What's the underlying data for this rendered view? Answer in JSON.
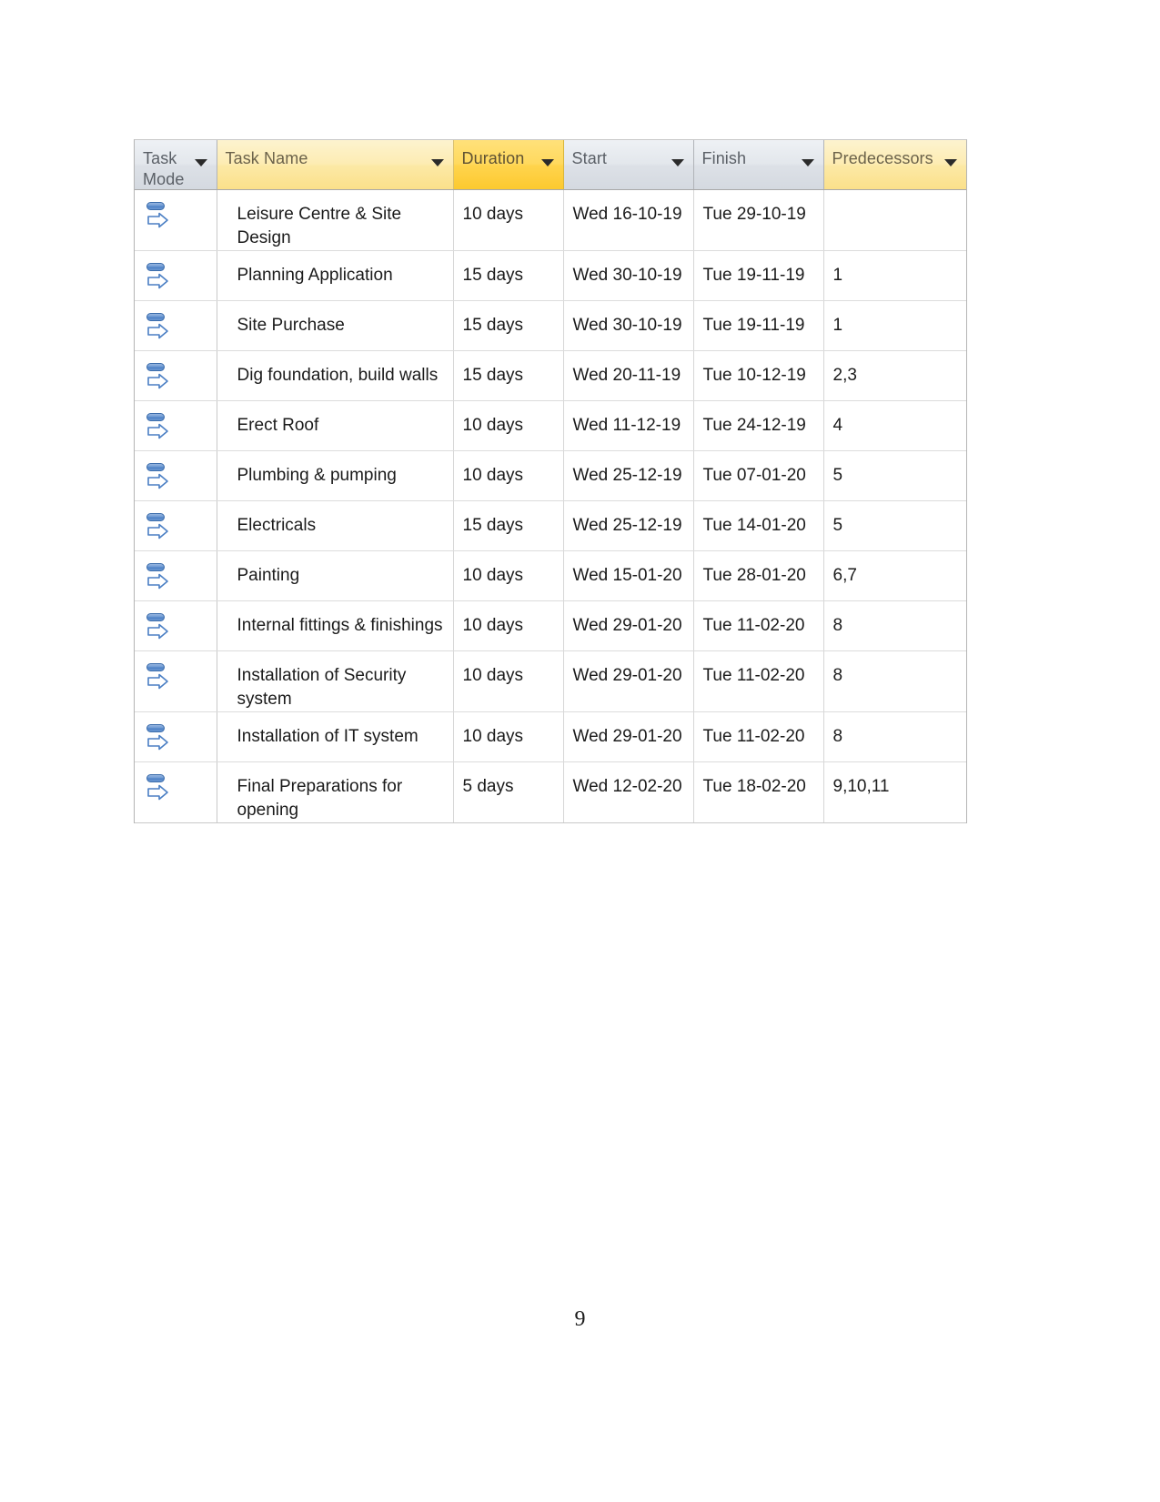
{
  "document": {
    "page_number": "9"
  },
  "table": {
    "name": "project-task-table",
    "columns": [
      {
        "id": "task_mode",
        "label": "Task\nMode",
        "style": "grey"
      },
      {
        "id": "task_name",
        "label": "Task Name",
        "style": "light-yellow"
      },
      {
        "id": "duration",
        "label": "Duration",
        "style": "gold"
      },
      {
        "id": "start",
        "label": "Start",
        "style": "grey"
      },
      {
        "id": "finish",
        "label": "Finish",
        "style": "grey"
      },
      {
        "id": "predecessors",
        "label": "Predecessors",
        "style": "light-yellow"
      }
    ],
    "filter_icon": "chevron-down-icon",
    "task_mode_icon": "manually-scheduled-task-icon",
    "rows": [
      {
        "task_name": "Leisure Centre & Site Design",
        "duration": "10 days",
        "start": "Wed 16-10-19",
        "finish": "Tue 29-10-19",
        "predecessors": ""
      },
      {
        "task_name": "Planning Application",
        "duration": "15 days",
        "start": "Wed 30-10-19",
        "finish": "Tue 19-11-19",
        "predecessors": "1"
      },
      {
        "task_name": "Site Purchase",
        "duration": "15 days",
        "start": "Wed 30-10-19",
        "finish": "Tue 19-11-19",
        "predecessors": "1"
      },
      {
        "task_name": "Dig foundation, build walls",
        "duration": "15 days",
        "start": "Wed 20-11-19",
        "finish": "Tue 10-12-19",
        "predecessors": "2,3"
      },
      {
        "task_name": "Erect Roof",
        "duration": "10 days",
        "start": "Wed 11-12-19",
        "finish": "Tue 24-12-19",
        "predecessors": "4"
      },
      {
        "task_name": "Plumbing & pumping",
        "duration": "10 days",
        "start": "Wed 25-12-19",
        "finish": "Tue 07-01-20",
        "predecessors": "5"
      },
      {
        "task_name": "Electricals",
        "duration": "15 days",
        "start": "Wed 25-12-19",
        "finish": "Tue 14-01-20",
        "predecessors": "5"
      },
      {
        "task_name": "Painting",
        "duration": "10 days",
        "start": "Wed 15-01-20",
        "finish": "Tue 28-01-20",
        "predecessors": "6,7"
      },
      {
        "task_name": "Internal fittings & finishings",
        "duration": "10 days",
        "start": "Wed 29-01-20",
        "finish": "Tue 11-02-20",
        "predecessors": "8"
      },
      {
        "task_name": "Installation of Security system",
        "duration": "10 days",
        "start": "Wed 29-01-20",
        "finish": "Tue 11-02-20",
        "predecessors": "8"
      },
      {
        "task_name": "Installation of IT system",
        "duration": "10 days",
        "start": "Wed 29-01-20",
        "finish": "Tue 11-02-20",
        "predecessors": "8"
      },
      {
        "task_name": "Final Preparations for opening",
        "duration": "5 days",
        "start": "Wed 12-02-20",
        "finish": "Tue 18-02-20",
        "predecessors": "9,10,11"
      }
    ]
  },
  "colors": {
    "header_gold": "#ffd44d",
    "header_light_yellow": "#fce9a6",
    "header_grey": "#dde1e7",
    "task_mode_icon_blue": "#4b7fc4",
    "grid_line": "#d6d6d6",
    "text": "#1b1b1b"
  }
}
